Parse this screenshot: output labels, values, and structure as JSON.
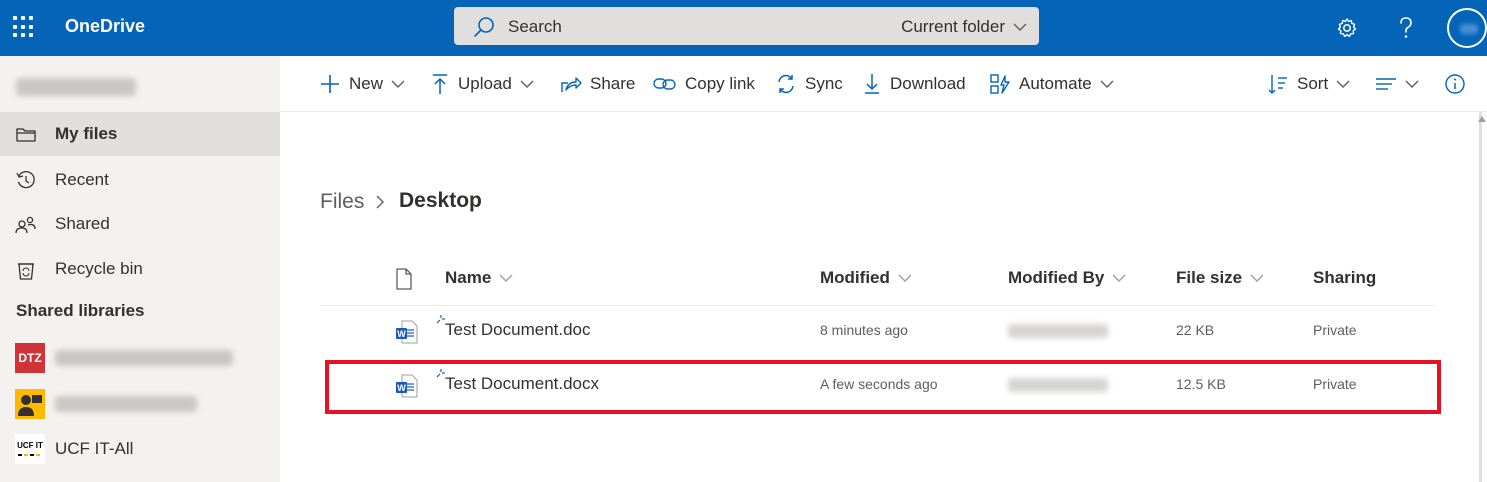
{
  "app": {
    "brand": "OneDrive",
    "accent": "#0364b8"
  },
  "search": {
    "placeholder": "Search",
    "scope": "Current folder"
  },
  "topbar": {
    "icons": [
      "waffle-icon",
      "settings-icon",
      "help-icon",
      "avatar"
    ]
  },
  "sidebar": {
    "items": [
      {
        "label": "My files",
        "icon": "folder-icon",
        "active": true
      },
      {
        "label": "Recent",
        "icon": "history-icon"
      },
      {
        "label": "Shared",
        "icon": "people-icon"
      },
      {
        "label": "Recycle bin",
        "icon": "recycle-bin-icon"
      }
    ],
    "shared_libraries_label": "Shared libraries",
    "libraries": [
      {
        "label": "",
        "icon_text": "DTZ",
        "icon_color": "#d13438"
      },
      {
        "label": "",
        "icon_color": "#ffb900"
      },
      {
        "label": "UCF IT-All",
        "icon_text": "UCF IT"
      }
    ]
  },
  "commands": {
    "new": "New",
    "upload": "Upload",
    "share": "Share",
    "copy_link": "Copy link",
    "sync": "Sync",
    "download": "Download",
    "automate": "Automate",
    "sort": "Sort"
  },
  "breadcrumb": {
    "root": "Files",
    "current": "Desktop"
  },
  "columns": {
    "name": "Name",
    "modified": "Modified",
    "modified_by": "Modified By",
    "file_size": "File size",
    "sharing": "Sharing"
  },
  "files": [
    {
      "name": "Test Document.doc",
      "modified": "8 minutes ago",
      "size": "22 KB",
      "sharing": "Private"
    },
    {
      "name": "Test Document.docx",
      "modified": "A few seconds ago",
      "size": "12.5 KB",
      "sharing": "Private",
      "highlighted": true
    }
  ],
  "highlight_color": "#e81123"
}
